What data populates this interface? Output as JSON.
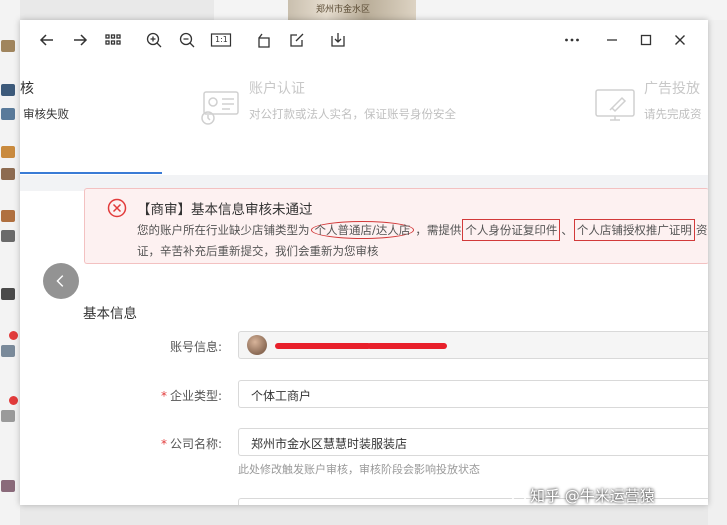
{
  "toolbar": {
    "icons": [
      "back-arrow-icon",
      "forward-arrow-icon",
      "grid-icon",
      "zoom-in-icon",
      "zoom-out-icon",
      "actual-size-icon",
      "rotate-icon",
      "edit-icon",
      "download-icon",
      "more-icon",
      "minimize-icon",
      "maximize-icon",
      "close-icon"
    ],
    "actual_size_label": "1:1"
  },
  "steps": [
    {
      "title": "核",
      "desc": "审核失败",
      "active": true
    },
    {
      "title": "账户认证",
      "desc": "对公打款或法人实名，保证账号身份安全",
      "active": false
    },
    {
      "title": "广告投放",
      "desc": "请先完成资",
      "active": false
    }
  ],
  "alert": {
    "title": "【商审】基本信息审核未通过",
    "line1": {
      "prefix": "您的账户所在行业缺少店铺类型为",
      "hl1": "个人普通店/达人店",
      "mid": "，需提供",
      "hl2": "个人身份证复印件",
      "sep": "、",
      "hl3": "个人店铺授权推广证明",
      "suffix": "资"
    },
    "line2": "证，辛苦补充后重新提交，我们会重新为您审核"
  },
  "section": {
    "title": "基本信息"
  },
  "form": {
    "account": {
      "label": "账号信息:"
    },
    "company_type": {
      "required": "*",
      "label": "企业类型:",
      "value": "个体工商户"
    },
    "company_name": {
      "required": "*",
      "label": "公司名称:",
      "value": "郑州市金水区慧慧时装服装店",
      "hint": "此处修改触发账户审核，审核阶段会影响投放状态"
    }
  },
  "background": {
    "top_photo_text": "郑州市金水区"
  },
  "watermark": {
    "text": "知乎 @牛米运营猿"
  },
  "colors": {
    "accent": "#3a7bd5",
    "error": "#e23b3b",
    "redaction": "#e8202b"
  }
}
